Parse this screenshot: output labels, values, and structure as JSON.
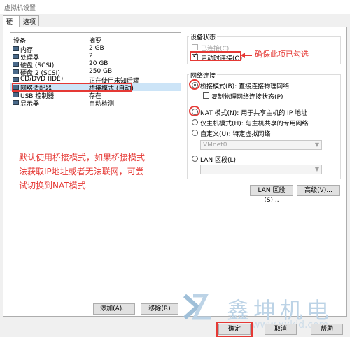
{
  "window": {
    "title": "虚拟机设置"
  },
  "tabs": [
    {
      "label": "硬件"
    },
    {
      "label": "选项"
    }
  ],
  "device_list": {
    "headers": {
      "device": "设备",
      "summary": "摘要"
    },
    "rows": [
      {
        "device": "内存",
        "summary": "2 GB",
        "icon": "memory-icon"
      },
      {
        "device": "处理器",
        "summary": "2",
        "icon": "cpu-icon"
      },
      {
        "device": "硬盘 (SCSI)",
        "summary": "20 GB",
        "icon": "harddisk-icon"
      },
      {
        "device": "硬盘 2 (SCSI)",
        "summary": "250 GB",
        "icon": "harddisk-icon"
      },
      {
        "device": "CD/DVD (IDE)",
        "summary": "正在使用未知后端",
        "icon": "cdrom-icon"
      },
      {
        "device": "网络适配器",
        "summary": "桥接模式 (自动)",
        "icon": "network-adapter-icon"
      },
      {
        "device": "USB 控制器",
        "summary": "存在",
        "icon": "usb-icon"
      },
      {
        "device": "显示器",
        "summary": "自动检测",
        "icon": "display-icon"
      }
    ]
  },
  "annotations": {
    "check_note": "确保此项已勾选",
    "main_note_lines": [
      "默认使用桥接模式，如果桥接模式",
      "法获取IP地址或者无法联网，可尝",
      "试切换到NAT模式"
    ]
  },
  "device_status": {
    "title": "设备状态",
    "connected": "已连接(C)",
    "connect_on_start": "启动时连接(O)"
  },
  "network": {
    "title": "网络连接",
    "bridged": "桥接模式(B): 直接连接物理网络",
    "replicate": "复制物理网络连接状态(P)",
    "nat": "NAT 模式(N): 用于共享主机的 IP 地址",
    "hostonly": "仅主机模式(H): 与主机共享的专用网络",
    "custom": "自定义(U): 特定虚拟网络",
    "custom_value": "VMnet0",
    "lan": "LAN 区段(L):",
    "lan_value": ""
  },
  "buttons": {
    "lan_segment": "LAN 区段(S)...",
    "advanced": "高级(V)...",
    "add": "添加(A)...",
    "remove": "移除(R)",
    "ok": "确定",
    "cancel": "取消",
    "help": "帮助"
  },
  "watermark": {
    "brand": "鑫坤机电",
    "url": "www.xxkjd.com"
  }
}
